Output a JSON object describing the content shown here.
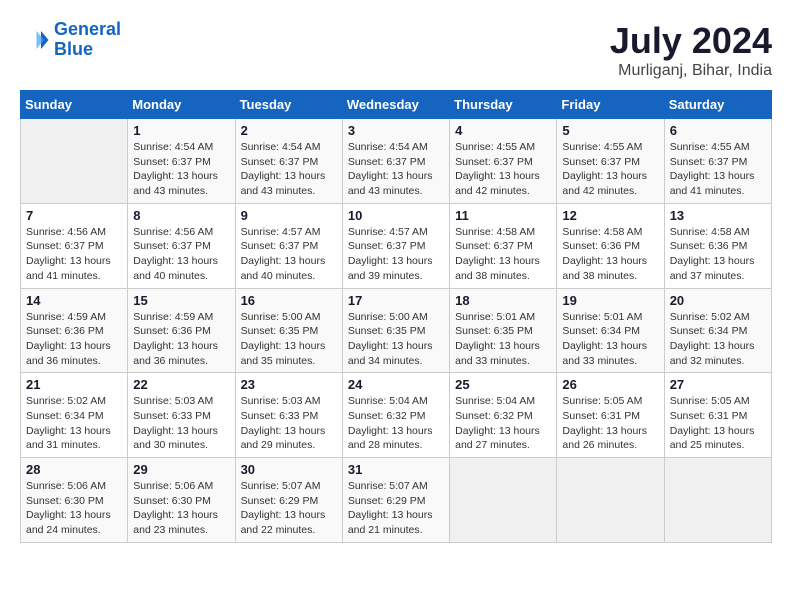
{
  "header": {
    "logo_line1": "General",
    "logo_line2": "Blue",
    "month_year": "July 2024",
    "location": "Murliganj, Bihar, India"
  },
  "columns": [
    "Sunday",
    "Monday",
    "Tuesday",
    "Wednesday",
    "Thursday",
    "Friday",
    "Saturday"
  ],
  "weeks": [
    [
      {
        "day": "",
        "sunrise": "",
        "sunset": "",
        "daylight": ""
      },
      {
        "day": "1",
        "sunrise": "Sunrise: 4:54 AM",
        "sunset": "Sunset: 6:37 PM",
        "daylight": "Daylight: 13 hours and 43 minutes."
      },
      {
        "day": "2",
        "sunrise": "Sunrise: 4:54 AM",
        "sunset": "Sunset: 6:37 PM",
        "daylight": "Daylight: 13 hours and 43 minutes."
      },
      {
        "day": "3",
        "sunrise": "Sunrise: 4:54 AM",
        "sunset": "Sunset: 6:37 PM",
        "daylight": "Daylight: 13 hours and 43 minutes."
      },
      {
        "day": "4",
        "sunrise": "Sunrise: 4:55 AM",
        "sunset": "Sunset: 6:37 PM",
        "daylight": "Daylight: 13 hours and 42 minutes."
      },
      {
        "day": "5",
        "sunrise": "Sunrise: 4:55 AM",
        "sunset": "Sunset: 6:37 PM",
        "daylight": "Daylight: 13 hours and 42 minutes."
      },
      {
        "day": "6",
        "sunrise": "Sunrise: 4:55 AM",
        "sunset": "Sunset: 6:37 PM",
        "daylight": "Daylight: 13 hours and 41 minutes."
      }
    ],
    [
      {
        "day": "7",
        "sunrise": "Sunrise: 4:56 AM",
        "sunset": "Sunset: 6:37 PM",
        "daylight": "Daylight: 13 hours and 41 minutes."
      },
      {
        "day": "8",
        "sunrise": "Sunrise: 4:56 AM",
        "sunset": "Sunset: 6:37 PM",
        "daylight": "Daylight: 13 hours and 40 minutes."
      },
      {
        "day": "9",
        "sunrise": "Sunrise: 4:57 AM",
        "sunset": "Sunset: 6:37 PM",
        "daylight": "Daylight: 13 hours and 40 minutes."
      },
      {
        "day": "10",
        "sunrise": "Sunrise: 4:57 AM",
        "sunset": "Sunset: 6:37 PM",
        "daylight": "Daylight: 13 hours and 39 minutes."
      },
      {
        "day": "11",
        "sunrise": "Sunrise: 4:58 AM",
        "sunset": "Sunset: 6:37 PM",
        "daylight": "Daylight: 13 hours and 38 minutes."
      },
      {
        "day": "12",
        "sunrise": "Sunrise: 4:58 AM",
        "sunset": "Sunset: 6:36 PM",
        "daylight": "Daylight: 13 hours and 38 minutes."
      },
      {
        "day": "13",
        "sunrise": "Sunrise: 4:58 AM",
        "sunset": "Sunset: 6:36 PM",
        "daylight": "Daylight: 13 hours and 37 minutes."
      }
    ],
    [
      {
        "day": "14",
        "sunrise": "Sunrise: 4:59 AM",
        "sunset": "Sunset: 6:36 PM",
        "daylight": "Daylight: 13 hours and 36 minutes."
      },
      {
        "day": "15",
        "sunrise": "Sunrise: 4:59 AM",
        "sunset": "Sunset: 6:36 PM",
        "daylight": "Daylight: 13 hours and 36 minutes."
      },
      {
        "day": "16",
        "sunrise": "Sunrise: 5:00 AM",
        "sunset": "Sunset: 6:35 PM",
        "daylight": "Daylight: 13 hours and 35 minutes."
      },
      {
        "day": "17",
        "sunrise": "Sunrise: 5:00 AM",
        "sunset": "Sunset: 6:35 PM",
        "daylight": "Daylight: 13 hours and 34 minutes."
      },
      {
        "day": "18",
        "sunrise": "Sunrise: 5:01 AM",
        "sunset": "Sunset: 6:35 PM",
        "daylight": "Daylight: 13 hours and 33 minutes."
      },
      {
        "day": "19",
        "sunrise": "Sunrise: 5:01 AM",
        "sunset": "Sunset: 6:34 PM",
        "daylight": "Daylight: 13 hours and 33 minutes."
      },
      {
        "day": "20",
        "sunrise": "Sunrise: 5:02 AM",
        "sunset": "Sunset: 6:34 PM",
        "daylight": "Daylight: 13 hours and 32 minutes."
      }
    ],
    [
      {
        "day": "21",
        "sunrise": "Sunrise: 5:02 AM",
        "sunset": "Sunset: 6:34 PM",
        "daylight": "Daylight: 13 hours and 31 minutes."
      },
      {
        "day": "22",
        "sunrise": "Sunrise: 5:03 AM",
        "sunset": "Sunset: 6:33 PM",
        "daylight": "Daylight: 13 hours and 30 minutes."
      },
      {
        "day": "23",
        "sunrise": "Sunrise: 5:03 AM",
        "sunset": "Sunset: 6:33 PM",
        "daylight": "Daylight: 13 hours and 29 minutes."
      },
      {
        "day": "24",
        "sunrise": "Sunrise: 5:04 AM",
        "sunset": "Sunset: 6:32 PM",
        "daylight": "Daylight: 13 hours and 28 minutes."
      },
      {
        "day": "25",
        "sunrise": "Sunrise: 5:04 AM",
        "sunset": "Sunset: 6:32 PM",
        "daylight": "Daylight: 13 hours and 27 minutes."
      },
      {
        "day": "26",
        "sunrise": "Sunrise: 5:05 AM",
        "sunset": "Sunset: 6:31 PM",
        "daylight": "Daylight: 13 hours and 26 minutes."
      },
      {
        "day": "27",
        "sunrise": "Sunrise: 5:05 AM",
        "sunset": "Sunset: 6:31 PM",
        "daylight": "Daylight: 13 hours and 25 minutes."
      }
    ],
    [
      {
        "day": "28",
        "sunrise": "Sunrise: 5:06 AM",
        "sunset": "Sunset: 6:30 PM",
        "daylight": "Daylight: 13 hours and 24 minutes."
      },
      {
        "day": "29",
        "sunrise": "Sunrise: 5:06 AM",
        "sunset": "Sunset: 6:30 PM",
        "daylight": "Daylight: 13 hours and 23 minutes."
      },
      {
        "day": "30",
        "sunrise": "Sunrise: 5:07 AM",
        "sunset": "Sunset: 6:29 PM",
        "daylight": "Daylight: 13 hours and 22 minutes."
      },
      {
        "day": "31",
        "sunrise": "Sunrise: 5:07 AM",
        "sunset": "Sunset: 6:29 PM",
        "daylight": "Daylight: 13 hours and 21 minutes."
      },
      {
        "day": "",
        "sunrise": "",
        "sunset": "",
        "daylight": ""
      },
      {
        "day": "",
        "sunrise": "",
        "sunset": "",
        "daylight": ""
      },
      {
        "day": "",
        "sunrise": "",
        "sunset": "",
        "daylight": ""
      }
    ]
  ]
}
